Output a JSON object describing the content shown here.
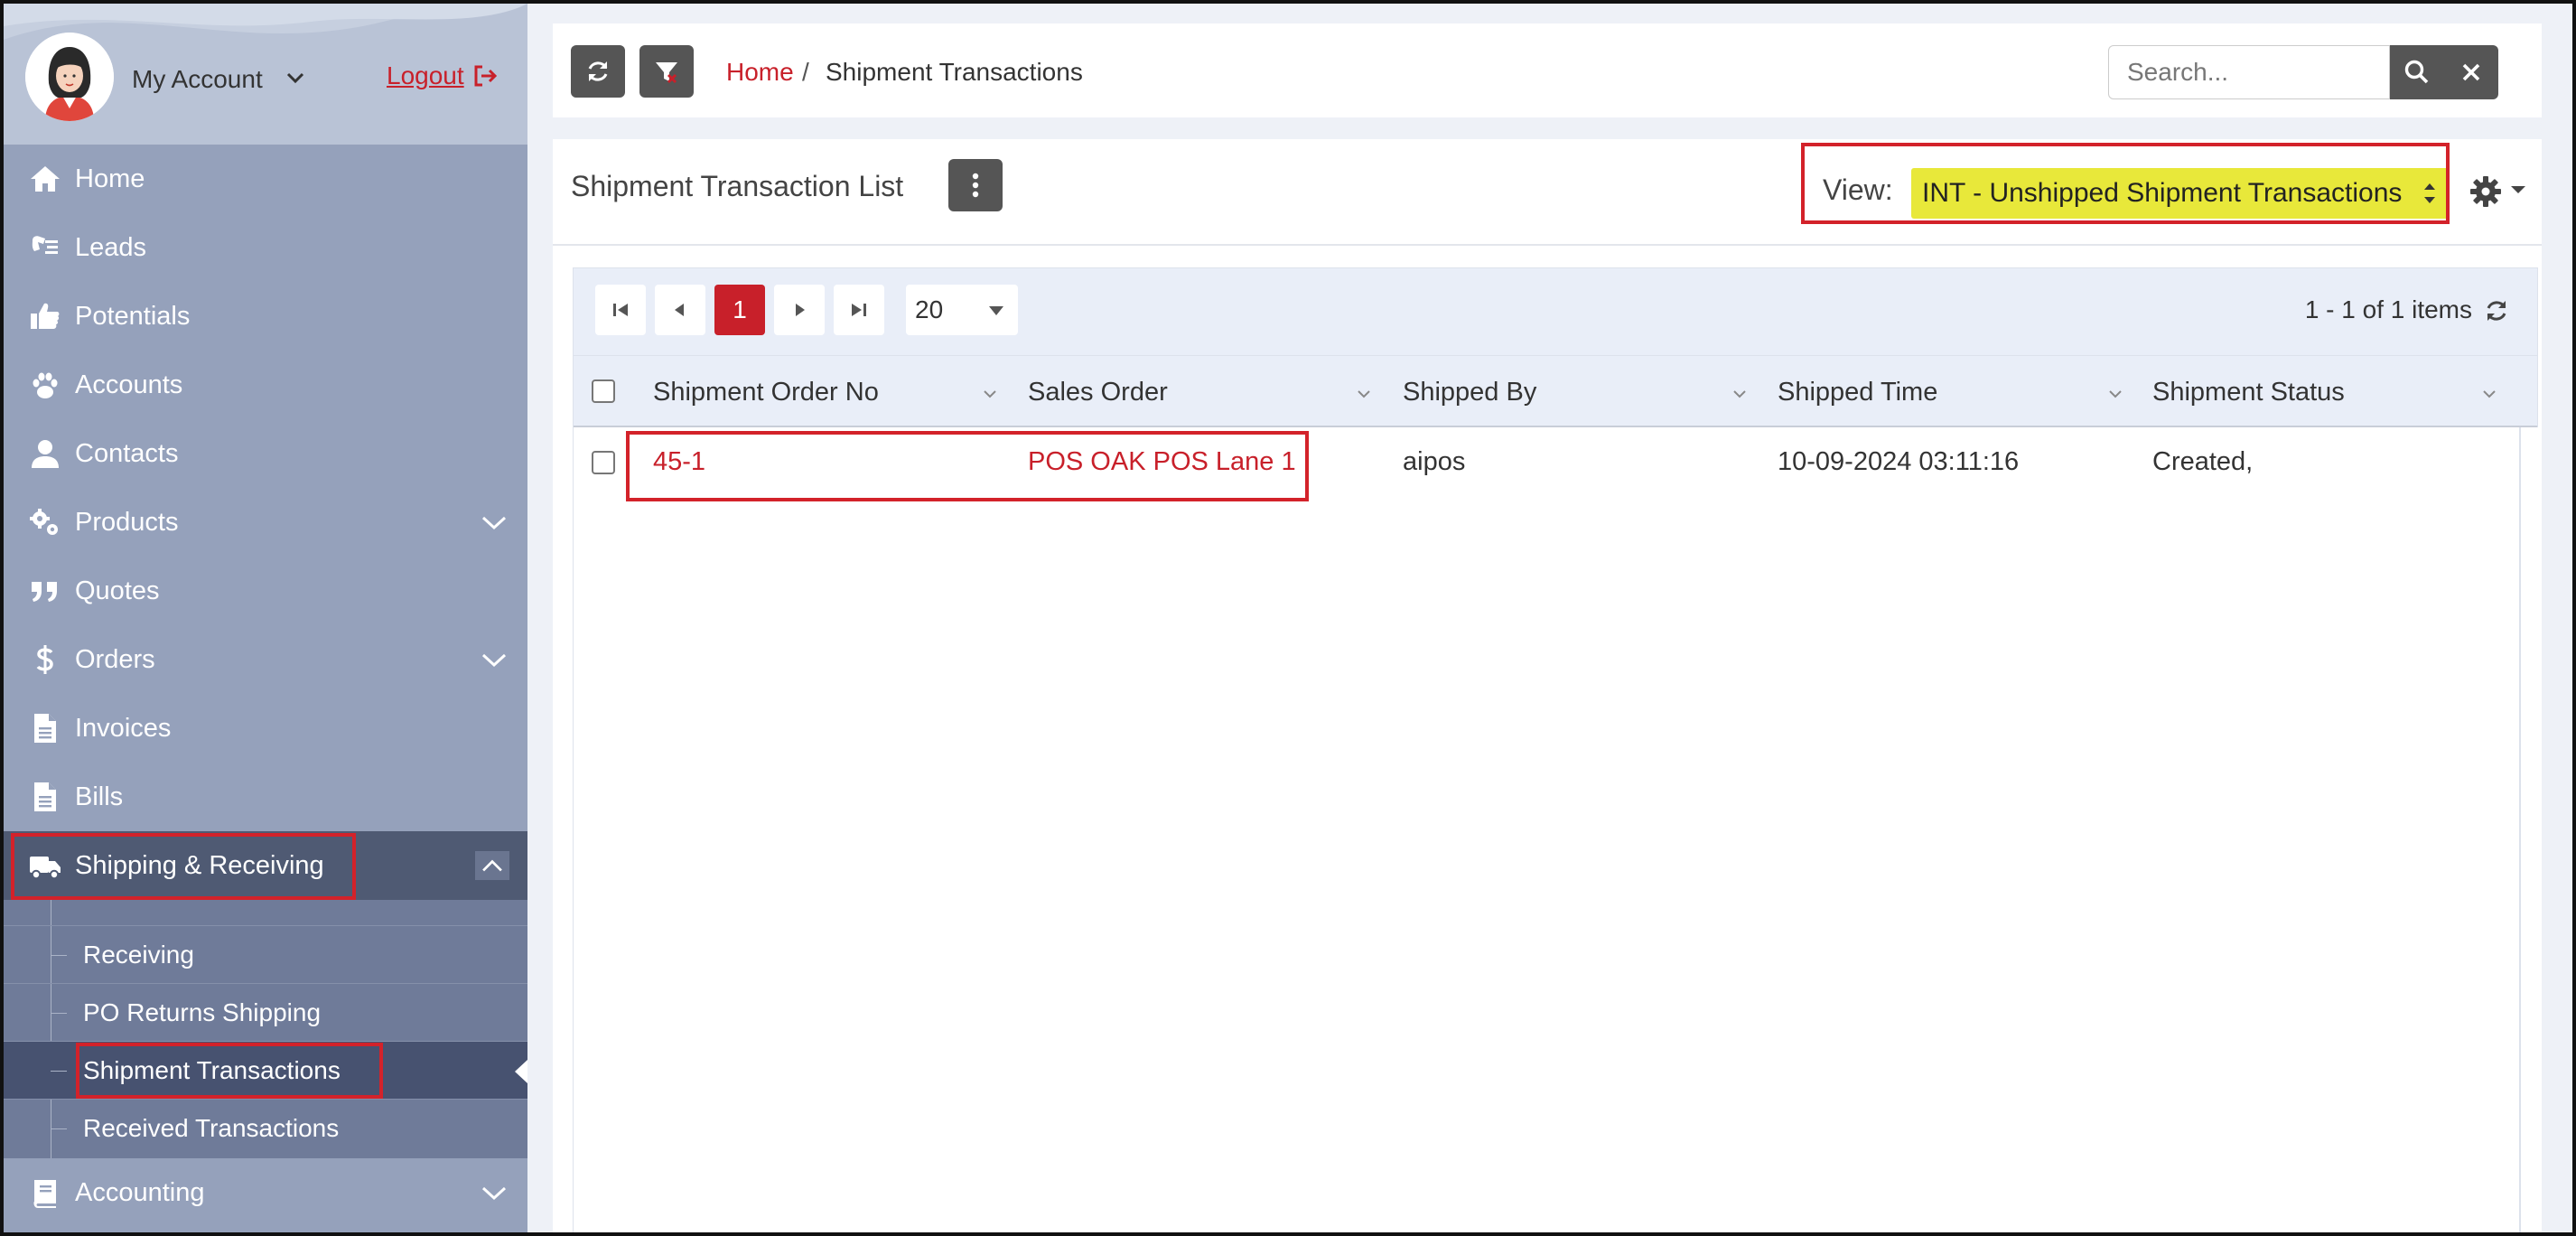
{
  "sidebar": {
    "account_label": "My Account",
    "logout_label": "Logout",
    "items": [
      {
        "label": "Home",
        "icon": "home-icon"
      },
      {
        "label": "Leads",
        "icon": "leads-icon"
      },
      {
        "label": "Potentials",
        "icon": "thumbs-up-icon"
      },
      {
        "label": "Accounts",
        "icon": "paw-icon"
      },
      {
        "label": "Contacts",
        "icon": "user-icon"
      },
      {
        "label": "Products",
        "icon": "gears-icon"
      },
      {
        "label": "Quotes",
        "icon": "quote-icon"
      },
      {
        "label": "Orders",
        "icon": "dollar-icon"
      },
      {
        "label": "Invoices",
        "icon": "document-icon"
      },
      {
        "label": "Bills",
        "icon": "document-icon"
      },
      {
        "label": "Shipping & Receiving",
        "icon": "truck-icon"
      },
      {
        "label": "Accounting",
        "icon": "book-icon"
      }
    ],
    "submenu": [
      {
        "label": "Receiving"
      },
      {
        "label": "PO Returns Shipping"
      },
      {
        "label": "Shipment Transactions"
      },
      {
        "label": "Received Transactions"
      }
    ]
  },
  "breadcrumb": {
    "home": "Home",
    "separator": "/",
    "current": "Shipment Transactions"
  },
  "search": {
    "placeholder": "Search..."
  },
  "panel": {
    "title": "Shipment Transaction List",
    "view_label": "View:",
    "view_selected": "INT - Unshipped Shipment Transactions"
  },
  "pager": {
    "current_page": "1",
    "page_size": "20",
    "info": "1 - 1 of 1 items"
  },
  "table": {
    "columns": [
      "Shipment Order No",
      "Sales Order",
      "Shipped By",
      "Shipped Time",
      "Shipment Status"
    ],
    "rows": [
      [
        "45-1",
        "POS OAK POS Lane 1",
        "aipos",
        "10-09-2024 03:11:16",
        "Created,"
      ]
    ]
  },
  "colors": {
    "accent_red": "#c8202a",
    "sidebar_bg": "#95a1bb",
    "sidebar_active": "#4f5a73",
    "view_highlight": "#e8e83a",
    "highlight_box": "#d3222a"
  }
}
